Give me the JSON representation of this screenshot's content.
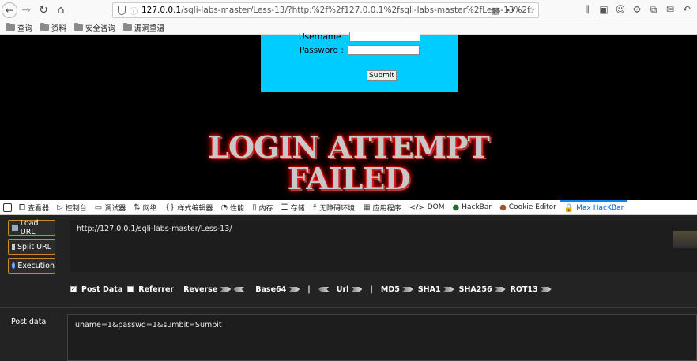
{
  "browser": {
    "url_prefix": "127.0.0.1",
    "url_rest": "/sqli-labs-master/Less-13/?http:%2f%2f127.0.0.1%2fsqli-labs-master%2fLess-13%2f",
    "bookmarks": [
      "查询",
      "资料",
      "安全咨询",
      "漏洞重温"
    ]
  },
  "page": {
    "username_label": "Username :",
    "password_label": "Password :",
    "submit_label": "Submit",
    "failed_line1": "LOGIN ATTEMPT",
    "failed_line2": "FAILED"
  },
  "devtools": {
    "tabs": [
      {
        "label": "查看器",
        "icon": "inspector-icon"
      },
      {
        "label": "控制台",
        "icon": "console-icon"
      },
      {
        "label": "调试器",
        "icon": "debugger-icon"
      },
      {
        "label": "网络",
        "icon": "network-icon"
      },
      {
        "label": "样式编辑器",
        "icon": "style-editor-icon"
      },
      {
        "label": "性能",
        "icon": "performance-icon"
      },
      {
        "label": "内存",
        "icon": "memory-icon"
      },
      {
        "label": "存储",
        "icon": "storage-icon"
      },
      {
        "label": "无障碍环境",
        "icon": "accessibility-icon"
      },
      {
        "label": "应用程序",
        "icon": "application-icon"
      },
      {
        "label": "DOM",
        "icon": "dom-icon"
      },
      {
        "label": "HackBar",
        "icon": "hackbar-icon"
      },
      {
        "label": "Cookie Editor",
        "icon": "cookie-icon"
      },
      {
        "label": "Max HacKBar",
        "icon": "lock-icon"
      }
    ],
    "active_tab": "Max HacKBar"
  },
  "hackbar": {
    "load_url": "Load URL",
    "split_url": "Split URL",
    "execution": "Execution",
    "url_value": "http://127.0.0.1/sqli-labs-master/Less-13/",
    "post_data_checked": true,
    "referrer_checked": false,
    "options": {
      "post_data": "Post Data",
      "referrer": "Referrer",
      "reverse": "Reverse",
      "base64": "Base64",
      "url": "Url",
      "md5": "MD5",
      "sha1": "SHA1",
      "sha256": "SHA256",
      "rot13": "ROT13",
      "separator": "|"
    },
    "post_label": "Post data",
    "post_value": "uname=1&passwd=1&sumbit=Sumbit"
  },
  "colors": {
    "login_box": "#00ccff",
    "button_border": "#c88a2a",
    "active_tab": "#0a84ff"
  }
}
